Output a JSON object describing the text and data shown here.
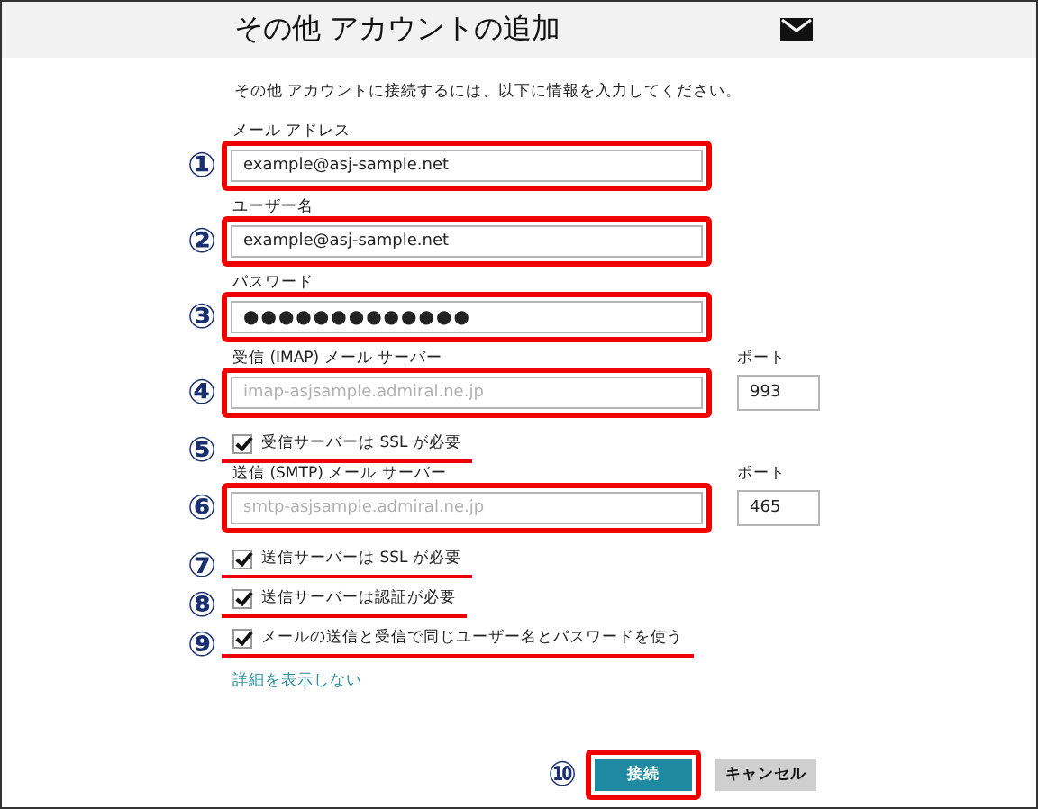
{
  "window": {
    "title": "その他 アカウントの追加"
  },
  "description": "その他 アカウントに接続するには、以下に情報を入力してください。",
  "form": [
    {
      "kind": "text_field",
      "label": "メール アドレス",
      "value": "example@asj-sample.net",
      "annotation": "①",
      "highlighted": true
    },
    {
      "kind": "text_field",
      "label": "ユーザー名",
      "value": "example@asj-sample.net",
      "annotation": "②",
      "highlighted": true
    },
    {
      "kind": "password_field",
      "label": "パスワード",
      "value": "●●●●●●●●●●●●●",
      "annotation": "③",
      "highlighted": true
    },
    {
      "kind": "text_field",
      "label": "受信 (IMAP) メール サーバー",
      "placeholder": "imap-asjsample.admiral.ne.jp",
      "annotation": "④",
      "highlighted": true,
      "port": {
        "label": "ポート",
        "value": "993"
      }
    },
    {
      "kind": "checkbox",
      "label": "受信サーバーは SSL が必要",
      "checked": true,
      "annotation": "⑤",
      "underlined": true
    },
    {
      "kind": "text_field",
      "label": "送信 (SMTP) メール サーバー",
      "placeholder": "smtp-asjsample.admiral.ne.jp",
      "annotation": "⑥",
      "highlighted": true,
      "port": {
        "label": "ポート",
        "value": "465"
      }
    },
    {
      "kind": "checkbox",
      "label": "送信サーバーは SSL が必要",
      "checked": true,
      "annotation": "⑦",
      "underlined": true
    },
    {
      "kind": "checkbox",
      "label": "送信サーバーは認証が必要",
      "checked": true,
      "annotation": "⑧",
      "underlined": true
    },
    {
      "kind": "checkbox",
      "label": "メールの送信と受信で同じユーザー名とパスワードを使う",
      "checked": true,
      "annotation": "⑨",
      "underlined": true
    }
  ],
  "link": "詳細を表示しない",
  "buttons": [
    {
      "kind": "primary",
      "label": "接続",
      "annotation": "⑩",
      "highlighted": true
    },
    {
      "kind": "secondary",
      "label": "キャンセル",
      "highlighted": false
    }
  ]
}
